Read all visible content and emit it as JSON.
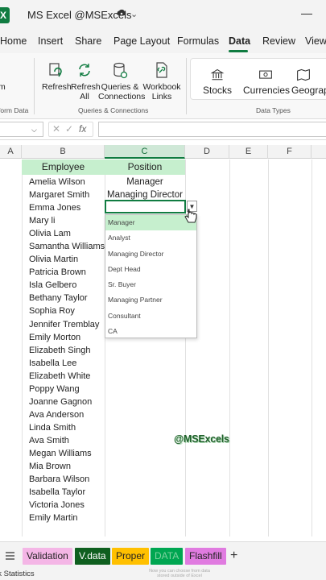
{
  "titlebar": {
    "app_logo": "X",
    "title": "MS Excel @MSExcels"
  },
  "menu": [
    "Home",
    "Insert",
    "Share",
    "Page Layout",
    "Formulas",
    "Data",
    "Review",
    "View"
  ],
  "ribbon": {
    "transform_label": "m",
    "transform_group": "form Data",
    "refresh": "Refresh",
    "refresh_all_1": "Refresh",
    "refresh_all_2": "All",
    "queries_1": "Queries &",
    "queries_2": "Connections",
    "workbook_1": "Workbook",
    "workbook_2": "Links",
    "queries_group": "Queries & Connections",
    "stocks": "Stocks",
    "currencies": "Currencies",
    "geography": "Geograph",
    "datatypes_group": "Data Types"
  },
  "formula": {
    "x": "✕",
    "check": "✓",
    "fx": "fx"
  },
  "columns": [
    "A",
    "B",
    "C",
    "D",
    "E",
    "F"
  ],
  "table": {
    "header_employee": "Employee",
    "header_position": "Position",
    "employees": [
      "Amelia Wilson",
      "Margaret Smith",
      "Emma Jones",
      "Mary li",
      "Olivia Lam",
      "Samantha Williams",
      "Olivia Martin",
      "Patricia Brown",
      "Isla Gelbero",
      "Bethany Taylor",
      "Sophia Roy",
      "Jennifer Tremblay",
      "Emily Morton",
      "Elizabeth Singh",
      "Isabella Lee",
      "Elizabeth White",
      "Poppy Wang",
      "Joanne Gagnon",
      "Ava Anderson",
      "Linda Smith",
      "Ava Smith",
      "Megan Williams",
      "Mia Brown",
      "Barbara Wilson",
      "Isabella Taylor",
      "Victoria Jones",
      "Emily Martin"
    ],
    "positions": [
      "Manager",
      "Managing Director"
    ]
  },
  "dropdown": {
    "options": [
      "Manager",
      "Analyst",
      "Managing Director",
      "Dept Head",
      "Sr. Buyer",
      "Managing Partner",
      "Consultant",
      "CA"
    ],
    "highlighted": "Manager"
  },
  "watermark": "@MSExcels",
  "sheets": [
    {
      "name": "Validation",
      "bg": "#f4b6e6",
      "fg": "#222222"
    },
    {
      "name": "V.data",
      "bg": "#0f5f1f",
      "fg": "#ffffff"
    },
    {
      "name": "Proper",
      "bg": "#ffc000",
      "fg": "#222222"
    },
    {
      "name": "DATA",
      "bg": "#00a651",
      "fg": "#7fd3a0"
    },
    {
      "name": "Flashfill",
      "bg": "#e07be0",
      "fg": "#222222"
    }
  ],
  "status": {
    "left": "ok Statistics",
    "faint": "Now you can choose from data stored outside of Excel"
  },
  "colors": {
    "accent": "#107c41",
    "header_fill": "#c6efce"
  }
}
